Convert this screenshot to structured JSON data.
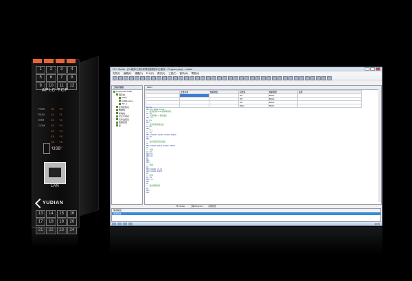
{
  "device": {
    "model": "APLC-TCP",
    "brand": "YUDIAN",
    "terminals_top": [
      "1",
      "2",
      "3",
      "4",
      "5",
      "6",
      "7",
      "8",
      "9",
      "10",
      "11",
      "12"
    ],
    "terminals_bottom": [
      "13",
      "14",
      "15",
      "16",
      "17",
      "18",
      "19",
      "20",
      "21",
      "22",
      "23",
      "24"
    ],
    "io_rows": [
      [
        "PWR",
        "X0",
        "Y0"
      ],
      [
        "RUN",
        "X1",
        "Y1"
      ],
      [
        "ERR",
        "X2",
        "Y2"
      ],
      [
        "COM",
        "X3",
        "Y3"
      ],
      [
        "",
        "X4",
        "Y4"
      ],
      [
        "",
        "X5",
        "Y5"
      ],
      [
        "",
        "X6",
        "Y6"
      ],
      [
        "",
        "X7",
        "Y7"
      ]
    ],
    "usb_label": "USB",
    "lan_label": "LAN"
  },
  "software": {
    "title": "PLC Studio - [D:\\程序\\工程\\采样控制程序\\主程序 - Program.plcp] - Ladder",
    "menu": [
      "文件(F)",
      "编辑(E)",
      "视图(V)",
      "PLC(P)",
      "调试(D)",
      "工具(T)",
      "窗口(W)",
      "帮助(H)"
    ],
    "tree_header": "工程管理器",
    "tree_items": [
      "Program1(TCAB)",
      "程序块",
      "MAIN",
      "SUBRoutine",
      "INT_1",
      "全局变量表",
      "数据块",
      "系统块",
      "交叉引用表",
      "元件监控表",
      "数据类型",
      "库"
    ],
    "editor_tab": "MAIN",
    "var_headers": [
      "变量名称",
      "数据类型",
      "初始值",
      "数据类型",
      "注释"
    ],
    "var_rows": [
      [
        "",
        "",
        "INT",
        "BOOL",
        ""
      ],
      [
        "",
        "",
        "INT",
        "BOOL",
        ""
      ],
      [
        "",
        "",
        "INT",
        "BOOL",
        ""
      ],
      [
        "",
        "",
        "REAL",
        "BOOL",
        ""
      ]
    ],
    "code_lines": [
      "LD   M0",
      "MOV  D0.Reg0.Value",
      "// 检测通道Value值转换存储",
      "LD   X0",
      "// 计量参数 P 输出设定",
      "OUT  Y0",
      "LD   M1",
      "MOV  ",
      "// 温度控制参数设定",
      "LD   M2",
      "OUT  ",
      "// 写入",
      "LD   X1",
      "MOV  K00000  D1000  D2000  D3000",
      "LD   X2",
      "OUT  ",
      "// 设定温度实际值设定",
      "LD   ",
      "MOV  K0000  D1001  D2001  D3001",
      "LD   ",
      "// 计算",
      "LD   X3",
      "SUB  D0",
      "MOV  D1",
      "LD   ",
      "MUL  ",
      "MOV  ",
      "// 转换",
      "LD   ",
      "MOV  D2000  (1.0)",
      "ADD  D2000  D2001",
      "LD   ",
      "// 时间",
      "LD   X4",
      "MOV  T0",
      "OUT  ",
      "LD   ",
      "// 温度采样控制",
      "LD   ",
      "MOV  ",
      "OUT  "
    ],
    "status_tabs": [
      "PB_Studio",
      "工程(Program)",
      "系统属性"
    ],
    "output_header": "信息输出",
    "output_line": "编译完成",
    "clock": "10:25"
  }
}
